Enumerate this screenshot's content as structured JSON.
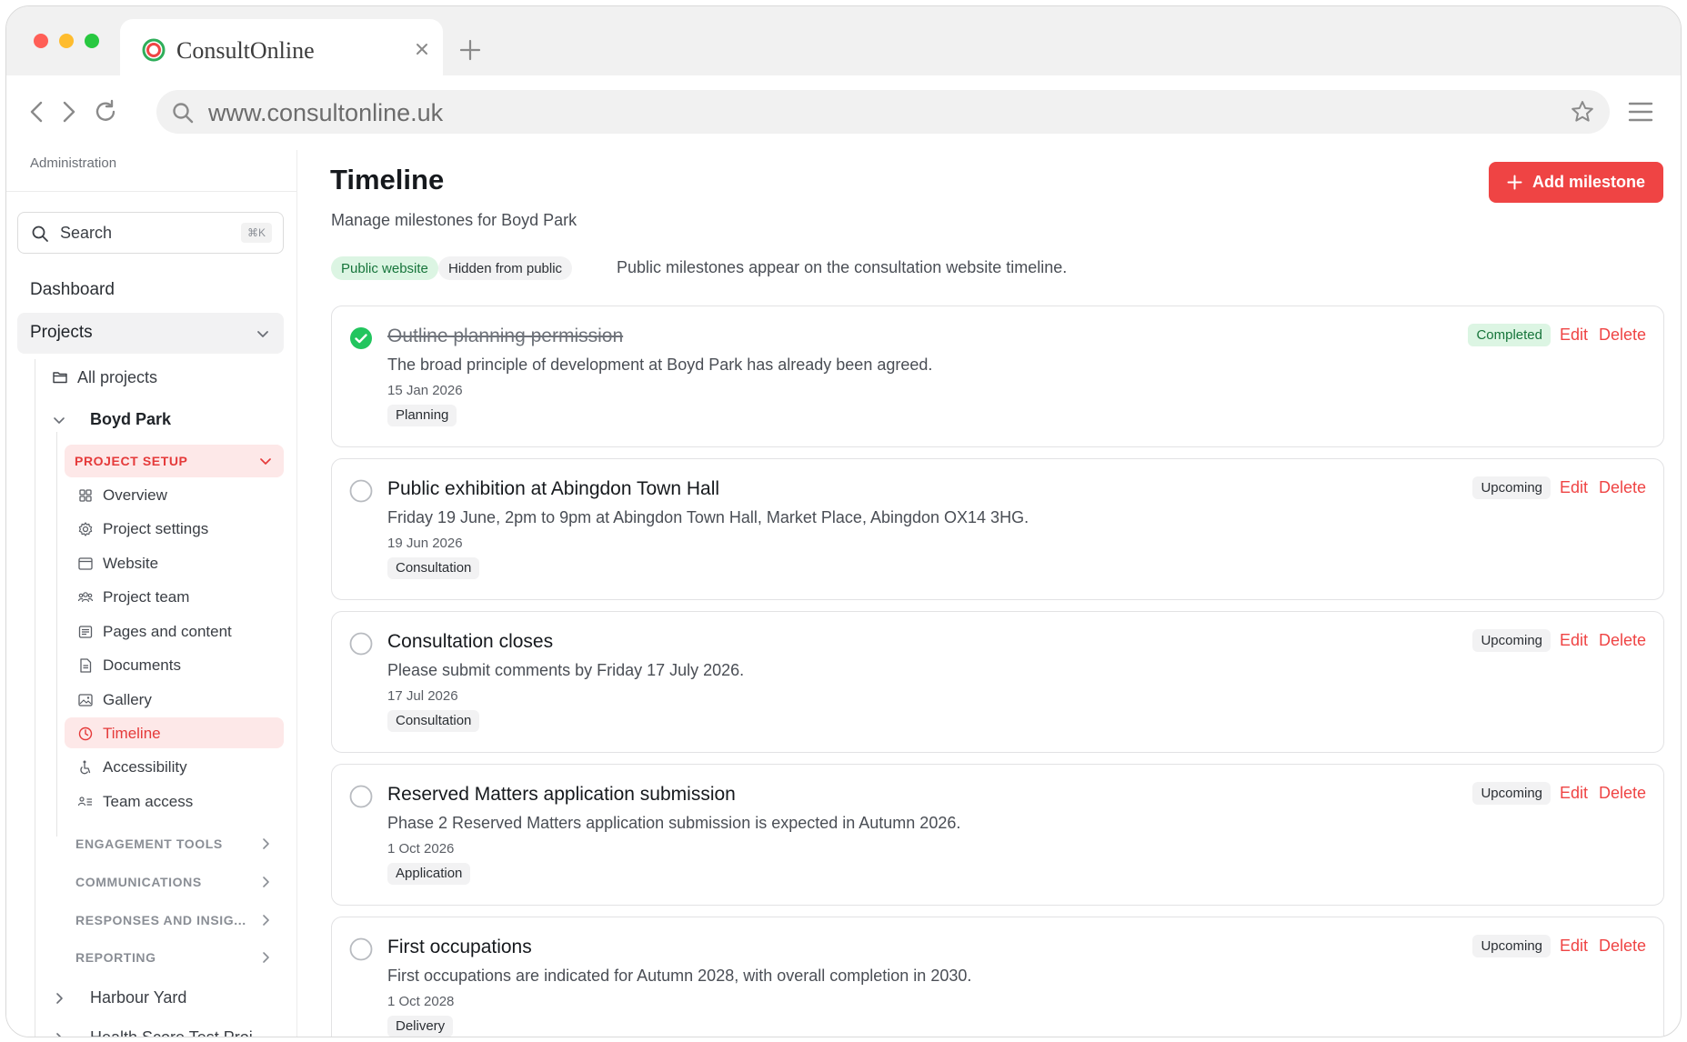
{
  "browser": {
    "tab_title": "ConsultOnline",
    "url": "www.consultonline.uk"
  },
  "sidebar": {
    "section_label": "Administration",
    "search": {
      "placeholder": "Search",
      "shortcut": "⌘K"
    },
    "dashboard": "Dashboard",
    "projects": "Projects",
    "all_projects": "All projects",
    "current_project": "Boyd Park",
    "setup_group": "PROJECT SETUP",
    "setup_items": [
      {
        "label": "Overview",
        "icon": "grid-icon"
      },
      {
        "label": "Project settings",
        "icon": "gear-icon"
      },
      {
        "label": "Website",
        "icon": "browser-icon"
      },
      {
        "label": "Project team",
        "icon": "team-icon"
      },
      {
        "label": "Pages and content",
        "icon": "pages-icon"
      },
      {
        "label": "Documents",
        "icon": "document-icon"
      },
      {
        "label": "Gallery",
        "icon": "image-icon"
      },
      {
        "label": "Timeline",
        "icon": "clock-icon",
        "active": true
      },
      {
        "label": "Accessibility",
        "icon": "accessibility-icon"
      },
      {
        "label": "Team access",
        "icon": "user-list-icon"
      }
    ],
    "collapsed_groups": [
      "ENGAGEMENT TOOLS",
      "COMMUNICATIONS",
      "RESPONSES AND INSIG...",
      "REPORTING"
    ],
    "other_projects": [
      "Harbour Yard",
      "Health Score Test Proj..."
    ]
  },
  "main": {
    "title": "Timeline",
    "subtitle": "Manage milestones for Boyd Park",
    "add_button": "Add milestone",
    "legend": {
      "public_chip": "Public website",
      "hidden_chip": "Hidden from public",
      "note": "Public milestones appear on the consultation website timeline."
    },
    "actions": {
      "edit": "Edit",
      "delete": "Delete"
    },
    "milestones": [
      {
        "title": "Outline planning permission",
        "description": "The broad principle of development at Boyd Park has already been agreed.",
        "date": "15 Jan 2026",
        "category": "Planning",
        "status": "Completed"
      },
      {
        "title": "Public exhibition at Abingdon Town Hall",
        "description": "Friday 19 June, 2pm to 9pm at Abingdon Town Hall, Market Place, Abingdon OX14 3HG.",
        "date": "19 Jun 2026",
        "category": "Consultation",
        "status": "Upcoming"
      },
      {
        "title": "Consultation closes",
        "description": "Please submit comments by Friday 17 July 2026.",
        "date": "17 Jul 2026",
        "category": "Consultation",
        "status": "Upcoming"
      },
      {
        "title": "Reserved Matters application submission",
        "description": "Phase 2 Reserved Matters application submission is expected in Autumn 2026.",
        "date": "1 Oct 2026",
        "category": "Application",
        "status": "Upcoming"
      },
      {
        "title": "First occupations",
        "description": "First occupations are indicated for Autumn 2028, with overall completion in 2030.",
        "date": "1 Oct 2028",
        "category": "Delivery",
        "status": "Upcoming"
      }
    ]
  },
  "colors": {
    "accent": "#ef4444",
    "accent_soft": "#fde8e8",
    "success": "#22c55e",
    "success_soft": "#dcf5e3"
  }
}
